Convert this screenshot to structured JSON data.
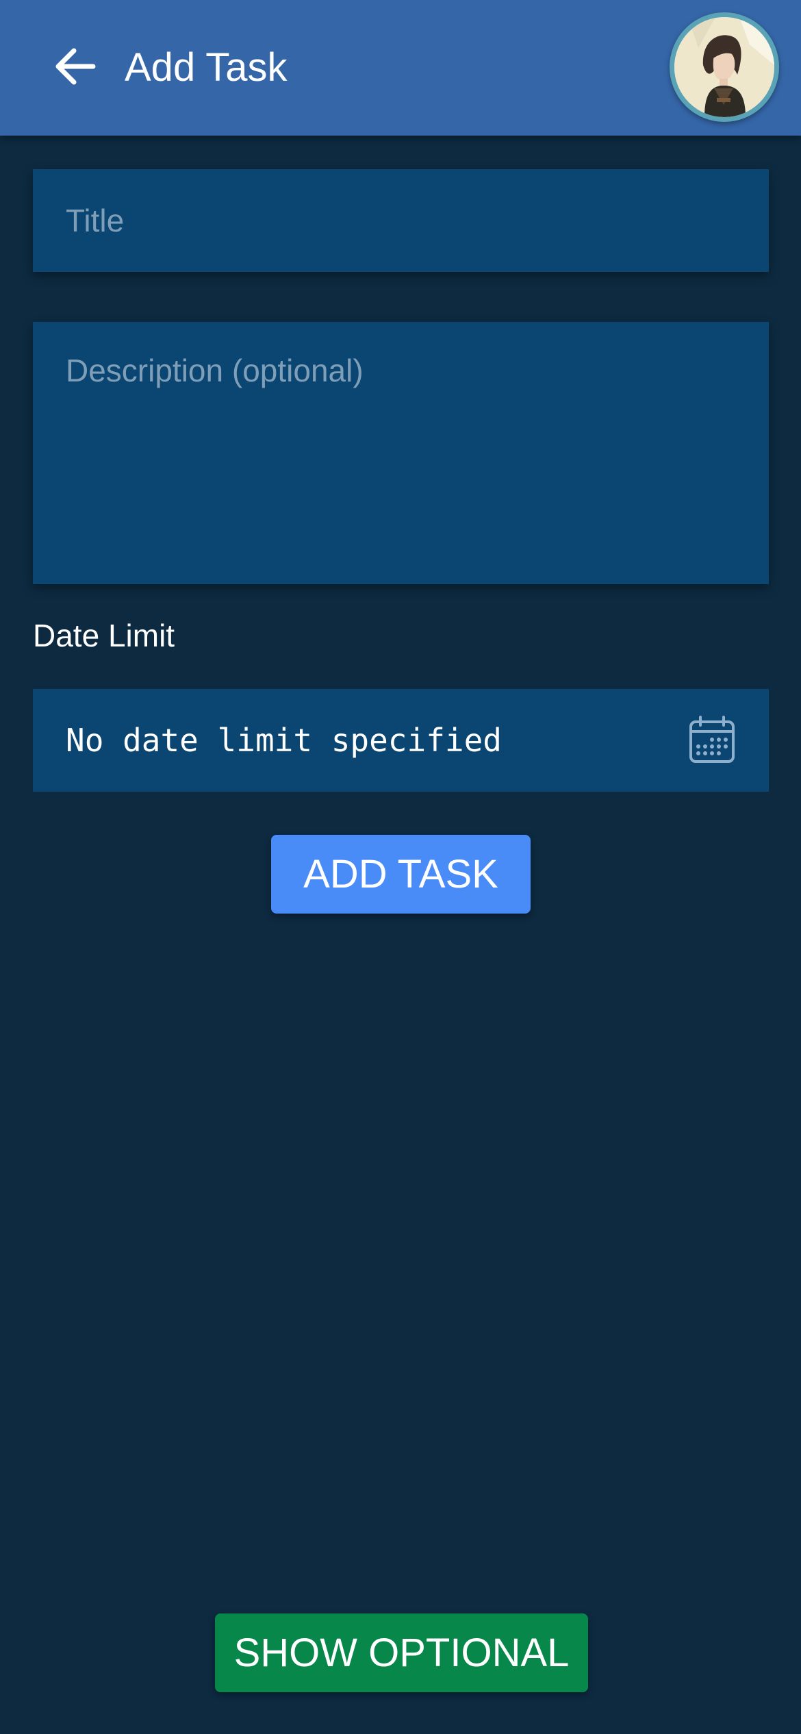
{
  "header": {
    "title": "Add Task",
    "back_icon": "arrow-left-icon",
    "avatar_icon": "user-avatar"
  },
  "form": {
    "title_placeholder": "Title",
    "title_value": "",
    "description_placeholder": "Description (optional)",
    "description_value": "",
    "date_limit_label": "Date Limit",
    "date_limit_value": "No date limit specified",
    "calendar_icon": "calendar-icon"
  },
  "actions": {
    "add_task_label": "ADD TASK",
    "show_optional_label": "SHOW OPTIONAL"
  },
  "colors": {
    "background": "#0d2a40",
    "appbar": "#3566a8",
    "field": "#0b4572",
    "primary_button": "#4a8cf7",
    "secondary_button": "#08874a"
  }
}
